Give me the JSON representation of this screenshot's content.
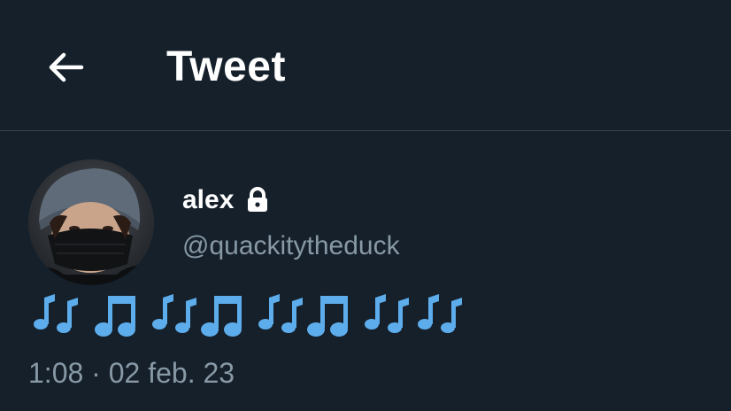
{
  "header": {
    "back_icon": "arrow-left-icon",
    "title": "Tweet"
  },
  "tweet": {
    "author": {
      "display_name": "alex",
      "protected_icon": "lock-icon",
      "handle": "@quackitytheduck",
      "avatar_icon": "avatar-photo"
    },
    "body_emoji": [
      "multiple-musical-notes",
      "musical-note",
      "multiple-musical-notes",
      "musical-note",
      "multiple-musical-notes",
      "musical-note",
      "multiple-musical-notes",
      "multiple-musical-notes"
    ],
    "timestamp": "1:08 · 02 feb. 23"
  },
  "colors": {
    "background": "#15202b",
    "divider": "#38444d",
    "secondary_text": "#8899a6",
    "emoji_blue": "#5dadec"
  }
}
